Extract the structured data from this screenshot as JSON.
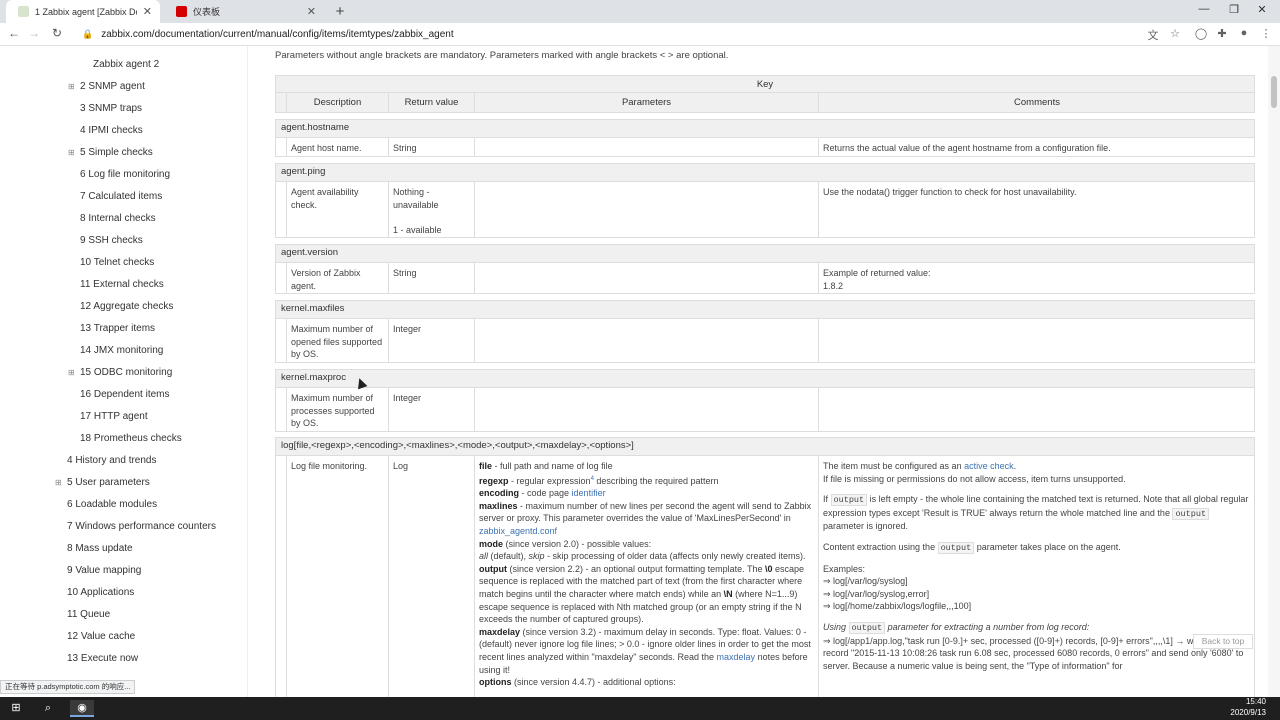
{
  "browser": {
    "tabs": [
      {
        "title": "1 Zabbix agent [Zabbix Docum",
        "active": true
      },
      {
        "title": "仪表板",
        "active": false
      }
    ],
    "url": "zabbix.com/documentation/current/manual/config/items/itemtypes/zabbix_agent"
  },
  "sidebar": {
    "items": [
      {
        "label": "Zabbix agent 2",
        "expandable": false
      },
      {
        "label": "2 SNMP agent",
        "expandable": true
      },
      {
        "label": "3 SNMP traps",
        "expandable": false
      },
      {
        "label": "4 IPMI checks",
        "expandable": false
      },
      {
        "label": "5 Simple checks",
        "expandable": true
      },
      {
        "label": "6 Log file monitoring",
        "expandable": false
      },
      {
        "label": "7 Calculated items",
        "expandable": false
      },
      {
        "label": "8 Internal checks",
        "expandable": false
      },
      {
        "label": "9 SSH checks",
        "expandable": false
      },
      {
        "label": "10 Telnet checks",
        "expandable": false
      },
      {
        "label": "11 External checks",
        "expandable": false
      },
      {
        "label": "12 Aggregate checks",
        "expandable": false
      },
      {
        "label": "13 Trapper items",
        "expandable": false
      },
      {
        "label": "14 JMX monitoring",
        "expandable": false
      },
      {
        "label": "15 ODBC monitoring",
        "expandable": true
      },
      {
        "label": "16 Dependent items",
        "expandable": false
      },
      {
        "label": "17 HTTP agent",
        "expandable": false
      },
      {
        "label": "18 Prometheus checks",
        "expandable": false
      },
      {
        "label": "4 History and trends",
        "expandable": false
      },
      {
        "label": "5 User parameters",
        "expandable": true
      },
      {
        "label": "6 Loadable modules",
        "expandable": false
      },
      {
        "label": "7 Windows performance counters",
        "expandable": false
      },
      {
        "label": "8 Mass update",
        "expandable": false
      },
      {
        "label": "9 Value mapping",
        "expandable": false
      },
      {
        "label": "10 Applications",
        "expandable": false
      },
      {
        "label": "11 Queue",
        "expandable": false
      },
      {
        "label": "12 Value cache",
        "expandable": false
      },
      {
        "label": "13 Execute now",
        "expandable": false
      }
    ]
  },
  "main": {
    "intro": "Parameters without angle brackets are mandatory. Parameters marked with angle brackets < > are optional.",
    "table": {
      "key_header": "Key",
      "columns": [
        "Description",
        "Return value",
        "Parameters",
        "Comments"
      ],
      "items": [
        {
          "key": "agent.hostname",
          "description": "Agent host name.",
          "return": "String",
          "params": "",
          "comments": "Returns the actual value of the agent hostname from a configuration file."
        },
        {
          "key": "agent.ping",
          "description": "Agent availability check.",
          "return": "Nothing - unavailable\n\n1 - available",
          "params": "",
          "comments": "Use the nodata() trigger function to check for host unavailability."
        },
        {
          "key": "agent.version",
          "description": "Version of Zabbix agent.",
          "return": "String",
          "params": "",
          "comments": "Example of returned value:\n1.8.2"
        },
        {
          "key": "kernel.maxfiles",
          "description": "Maximum number of opened files supported by OS.",
          "return": "Integer",
          "params": "",
          "comments": ""
        },
        {
          "key": "kernel.maxproc",
          "description": "Maximum number of processes supported by OS.",
          "return": "Integer",
          "params": "",
          "comments": ""
        },
        {
          "key": "log[file,<regexp>,<encoding>,<maxlines>,<mode>,<output>,<maxdelay>,<options>]",
          "description": "Log file monitoring.",
          "return": "Log",
          "params": "",
          "comments": ""
        }
      ],
      "log_params": {
        "file_b": "file",
        "file_t": " - full path and name of log file",
        "regexp_b": "regexp",
        "regexp_t1": " - regular expression",
        "regexp_sup": "4",
        "regexp_t2": " describing the required pattern",
        "encoding_b": "encoding",
        "encoding_t": " - code page ",
        "encoding_link": "identifier",
        "maxlines_b": "maxlines",
        "maxlines_t": " - maximum number of new lines per second the agent will send to Zabbix server or proxy. This parameter overrides the value of 'MaxLinesPerSecond' in ",
        "maxlines_link": "zabbix_agentd.conf",
        "mode_b": "mode",
        "mode_t1": " (since version 2.0) - possible values:",
        "mode_all": "all",
        "mode_t2": " (default), ",
        "mode_skip": "skip",
        "mode_t3": " - skip processing of older data (affects only newly created items).",
        "output_b": "output",
        "output_t1": " (since version 2.2) - an optional output formatting template. The ",
        "output_b2": "\\0",
        "output_t2": " escape sequence is replaced with the matched part of text (from the first character where match begins until the character where match ends) while an ",
        "output_b3": "\\N",
        "output_t3": " (where N=1...9) escape sequence is replaced with Nth matched group (or an empty string if the N exceeds the number of captured groups).",
        "maxdelay_b": "maxdelay",
        "maxdelay_t1": " (since version 3.2) - maximum delay in seconds. Type: float. Values: 0 - (default) never ignore log file lines; > 0.0 - ignore older lines in order to get the most recent lines analyzed within \"maxdelay\" seconds. Read the ",
        "maxdelay_link": "maxdelay",
        "maxdelay_t2": " notes before using it!",
        "options_b": "options",
        "options_t": " (since version 4.4.7) - additional options:"
      },
      "log_comments": {
        "c1_t1": "The item must be configured as an ",
        "c1_link": "active check",
        "c1_t2": ".",
        "c2": "If file is missing or permissions do not allow access, item turns unsupported.",
        "c3_t1": "If ",
        "c3_code": "output",
        "c3_t2": " is left empty - the whole line containing the matched text is returned. Note that all global regular expression types except 'Result is TRUE' always return the whole matched line and the ",
        "c3_code2": "output",
        "c3_t3": " parameter is ignored.",
        "c4_t1": "Content extraction using the ",
        "c4_code": "output",
        "c4_t2": " parameter takes place on the agent.",
        "c5": "Examples:",
        "ex1": "⇒ log[/var/log/syslog]",
        "ex2": "⇒ log[/var/log/syslog,error]",
        "ex3": "⇒ log[/home/zabbix/logs/logfile,,,100]",
        "c6_t1": "Using ",
        "c6_code": "output",
        "c6_t2": " parameter for extracting a number from log record:",
        "c7": "⇒ log[/app1/app.log,\"task run [0-9.]+ sec, processed ([0-9]+) records, [0-9]+ errors\",,,,\\1] → will match a log record \"2015-11-13 10:08:26 task run 6.08 sec, processed 6080 records, 0 errors\" and send only '6080' to server. Because a numeric value is being sent, the \"Type of information\" for"
      }
    }
  },
  "sidebar_links": {
    "back_to_top": "Back to top"
  },
  "status_text": "正在等待 p.adsymptotic.com 的响应...",
  "taskbar": {
    "time": "15:40",
    "date": "2020/9/13"
  }
}
